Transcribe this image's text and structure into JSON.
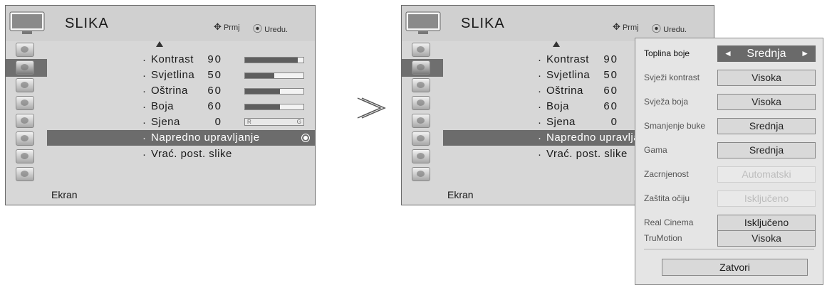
{
  "menu": {
    "title": "SLIKA",
    "hint_move": "Prmj",
    "hint_ok": "Uredu.",
    "move_glyph": "✥",
    "ok_glyph": "⦿",
    "footer": "Ekran",
    "sidebar_icons": [
      "picture-tab-icon",
      "screen-tab-icon",
      "audio-tab-icon",
      "time-tab-icon",
      "option-tab-icon",
      "lock-tab-icon",
      "input-tab-icon",
      "usb-tab-icon"
    ],
    "bullet": "·",
    "items": [
      {
        "label": "Kontrast",
        "value": "90",
        "level": 0.9
      },
      {
        "label": "Svjetlina",
        "value": "50",
        "level": 0.5
      },
      {
        "label": "Oštrina",
        "value": "60",
        "level": 0.6
      },
      {
        "label": "Boja",
        "value": "60",
        "level": 0.6
      },
      {
        "label": "Sjena",
        "value": "0",
        "tint_left": "R",
        "tint_right": "G"
      },
      {
        "label": "Napredno upravljanje"
      },
      {
        "label": "Vrać. post. slike"
      }
    ]
  },
  "popup": {
    "rows": [
      {
        "label": "Toplina boje",
        "value": "Srednja",
        "left_arrow": "◄",
        "right_arrow": "►"
      },
      {
        "label": "Svježi kontrast",
        "value": "Visoka"
      },
      {
        "label": "Svježa boja",
        "value": "Visoka"
      },
      {
        "label": "Smanjenje buke",
        "value": "Srednja"
      },
      {
        "label": "Gama",
        "value": "Srednja"
      },
      {
        "label": "Zacrnjenost",
        "value": "Automatski"
      },
      {
        "label": "Zaštita očiju",
        "value": "Isključeno"
      },
      {
        "label": "Real Cinema",
        "value": "Isključeno"
      },
      {
        "label": "TruMotion",
        "value": "Visoka"
      }
    ],
    "close": "Zatvori"
  },
  "colors": {
    "selected": "#6c6c6c",
    "panel": "#d7d7d7",
    "bar_fill": "#5e5e5e"
  }
}
